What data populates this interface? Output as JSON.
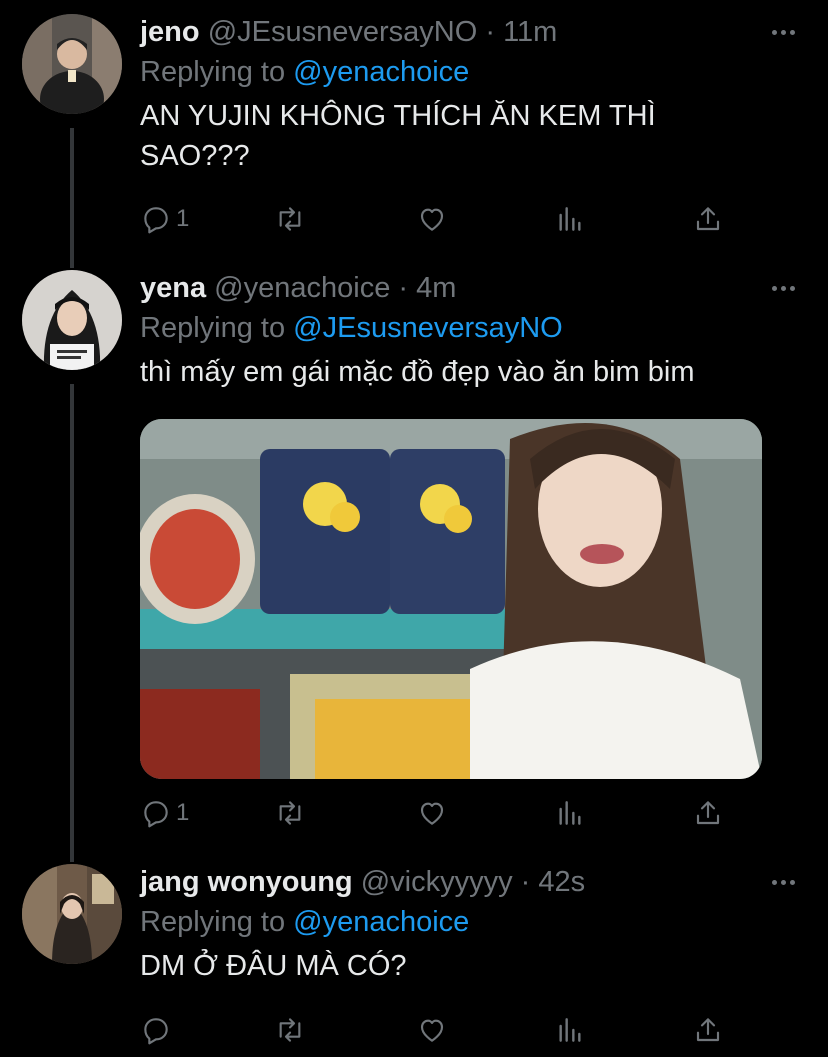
{
  "tweets": [
    {
      "name": "jeno",
      "handle": "@JEsusneversayNO",
      "time": "11m",
      "replying_label": "Replying to",
      "replying_to": "@yenachoice",
      "text_line1": "AN YUJIN KHÔNG THÍCH ĂN KEM THÌ",
      "text_line2": "SAO???",
      "reply_count": "1"
    },
    {
      "name": "yena",
      "handle": "@yenachoice",
      "time": "4m",
      "replying_label": "Replying to",
      "replying_to": "@JEsusneversayNO",
      "text_line1": "thì mấy em gái mặc đồ đẹp vào ăn bim bim",
      "reply_count": "1"
    },
    {
      "name": "jang wonyoung",
      "handle": "@vickyyyyy",
      "time": "42s",
      "replying_label": "Replying to",
      "replying_to": "@yenachoice",
      "text_line1": "DM Ở ĐÂU MÀ CÓ?"
    }
  ],
  "separator": "·",
  "icons": [
    "reply-icon",
    "retweet-icon",
    "like-icon",
    "analytics-icon",
    "share-icon",
    "more-icon"
  ],
  "colors": {
    "background": "#000000",
    "text": "#e7e9ea",
    "muted": "#71767b",
    "link": "#1d9bf0"
  }
}
